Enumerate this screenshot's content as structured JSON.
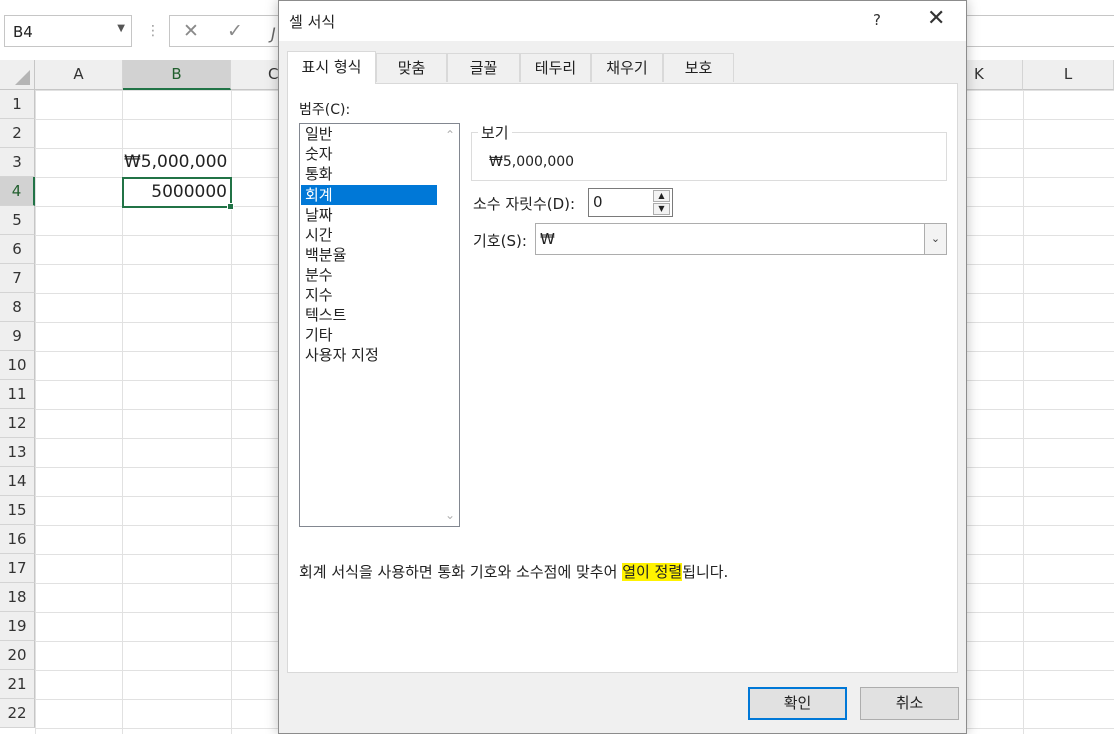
{
  "toolbar": {
    "name_box": "B4",
    "fx_symbol": "J"
  },
  "sheet": {
    "columns": [
      "A",
      "B",
      "C",
      "K",
      "L"
    ],
    "rows": [
      "1",
      "2",
      "3",
      "4",
      "5",
      "6",
      "7",
      "8",
      "9",
      "10",
      "11",
      "12",
      "13",
      "14",
      "15",
      "16",
      "17",
      "18",
      "19",
      "20",
      "21",
      "22"
    ],
    "cells": {
      "B3": "₩5,000,000",
      "B4": "5000000"
    }
  },
  "dialog": {
    "title": "셀 서식",
    "help": "?",
    "close": "✕",
    "tabs": [
      "표시 형식",
      "맞춤",
      "글꼴",
      "테두리",
      "채우기",
      "보호"
    ],
    "active_tab": "표시 형식",
    "category_label": "범주(C):",
    "categories": [
      "일반",
      "숫자",
      "통화",
      "회계",
      "날짜",
      "시간",
      "백분율",
      "분수",
      "지수",
      "텍스트",
      "기타",
      "사용자 지정"
    ],
    "selected_category": "회계",
    "preview_label": "보기",
    "preview_value": "₩5,000,000",
    "decimal_label": "소수 자릿수(D):",
    "decimal_value": "0",
    "symbol_label": "기호(S):",
    "symbol_value": "₩",
    "description_before": "회계 서식을 사용하면 통화 기호와 소수점에 맞추어 ",
    "description_highlight": "열이 정렬",
    "description_after": "됩니다.",
    "ok_label": "확인",
    "cancel_label": "취소"
  },
  "colors": {
    "accent_green": "#217346",
    "selection_blue": "#0078d7",
    "highlight": "#fff200"
  }
}
